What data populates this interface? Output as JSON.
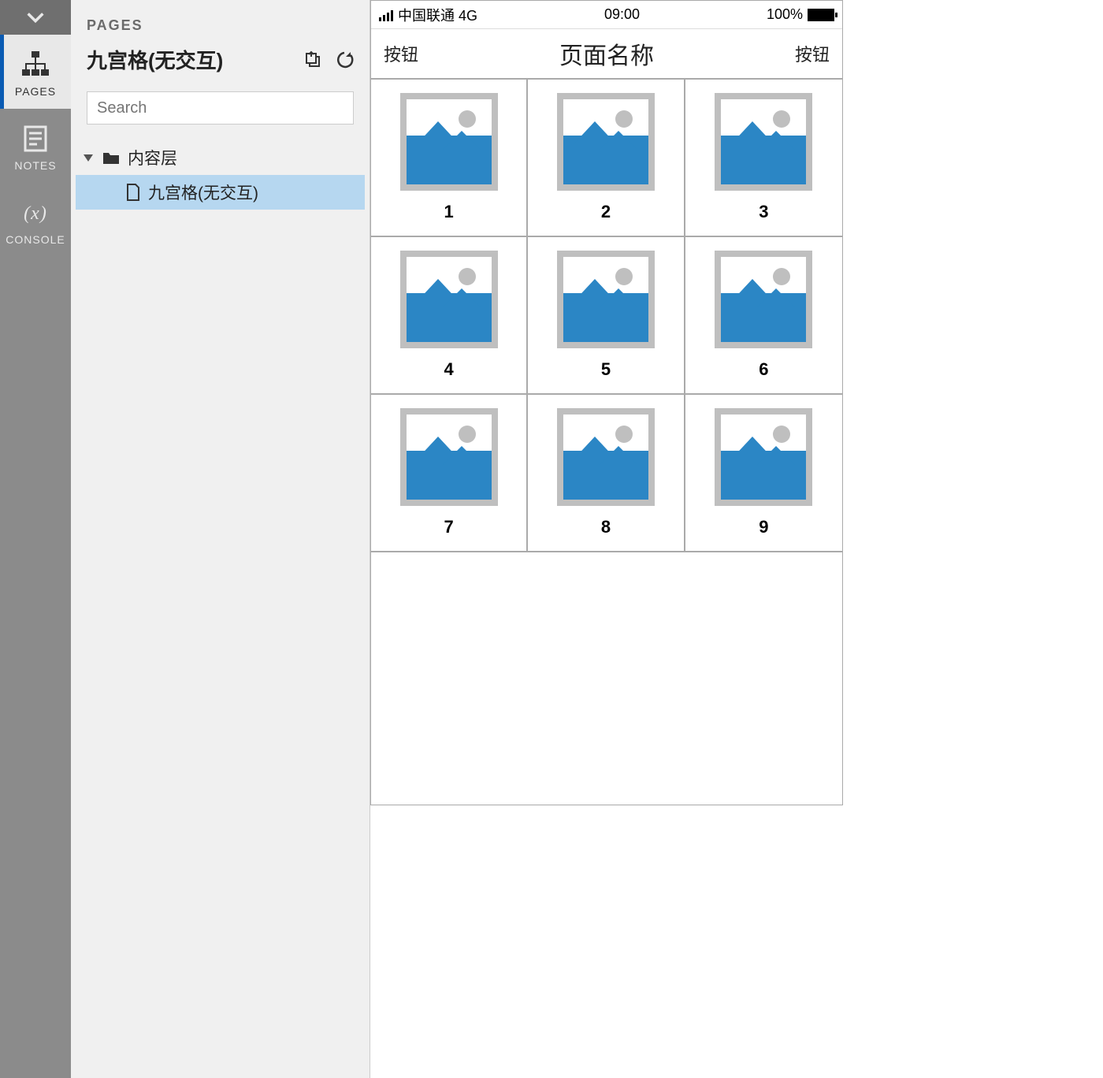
{
  "rail": {
    "items": [
      {
        "label": "PAGES"
      },
      {
        "label": "NOTES"
      },
      {
        "label": "CONSOLE"
      }
    ]
  },
  "sidebar": {
    "section_label": "PAGES",
    "title": "九宫格(无交互)",
    "search_placeholder": "Search",
    "tree": {
      "folder_label": "内容层",
      "page_label": "九宫格(无交互)"
    }
  },
  "device": {
    "status": {
      "carrier": "中国联通 4G",
      "time": "09:00",
      "battery": "100%"
    },
    "nav": {
      "left": "按钮",
      "title": "页面名称",
      "right": "按钮"
    },
    "cells": [
      {
        "label": "1"
      },
      {
        "label": "2"
      },
      {
        "label": "3"
      },
      {
        "label": "4"
      },
      {
        "label": "5"
      },
      {
        "label": "6"
      },
      {
        "label": "7"
      },
      {
        "label": "8"
      },
      {
        "label": "9"
      }
    ]
  }
}
